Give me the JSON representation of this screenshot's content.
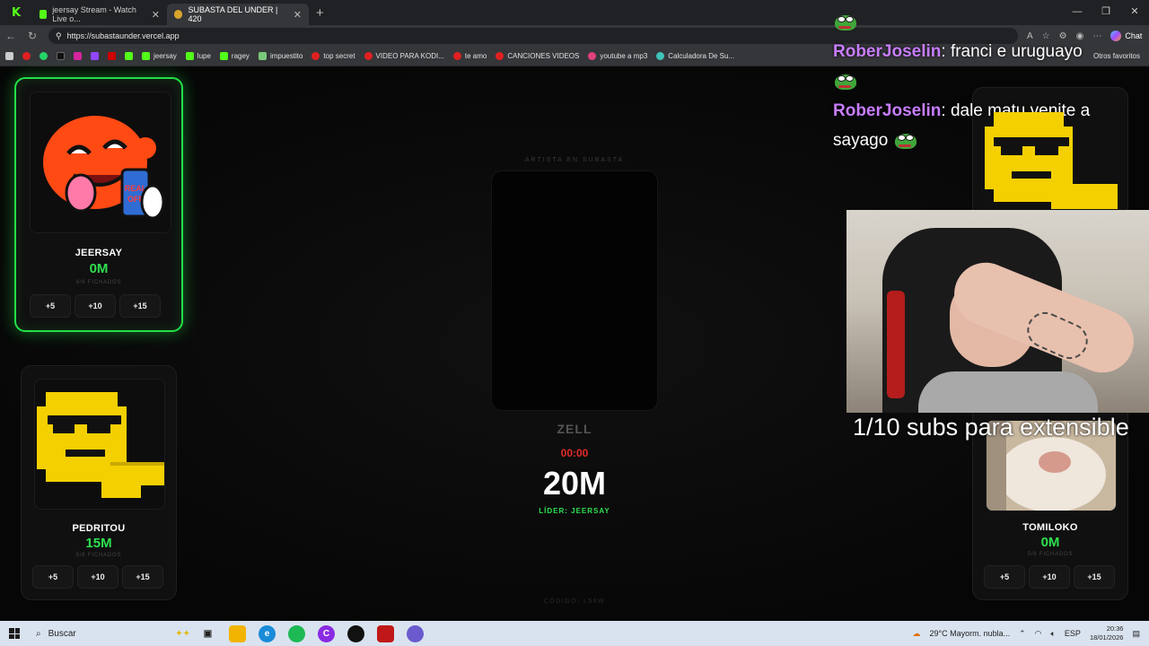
{
  "browser": {
    "tabs": [
      {
        "label": ""
      },
      {
        "label": "jeersay Stream - Watch Live o..."
      },
      {
        "label": "SUBASTA DEL UNDER | 420"
      }
    ],
    "new_tab": "+",
    "url": "https://subastaunder.vercel.app",
    "chat_label": "Chat",
    "bookmarks": [
      "",
      "",
      "",
      "",
      "",
      "",
      "jeersay",
      "lupe",
      "ragey",
      "impuestito",
      "top secret",
      "VIDEO PARA KODI...",
      "te amo",
      "CANCIONES VIDEOS",
      "youtube a mp3",
      "Calculadora De Su..."
    ],
    "bookmarks_right": "Otros favoritos"
  },
  "auction": {
    "center_label": "ARTISTA EN SUBASTA",
    "artist": "ZELL",
    "timer": "00:00",
    "current_bid": "20M",
    "leader": "LÍDER: JEERSAY",
    "faint": "",
    "code": "CÓDIGO: L56W"
  },
  "players": [
    {
      "name": "JEERSAY",
      "money": "0M",
      "signed": "6/6 FICHADOS",
      "bids": [
        "+5",
        "+10",
        "+15"
      ],
      "leader": true
    },
    {
      "name": "PEDRITOU",
      "money": "15M",
      "signed": "5/6 FICHADOS",
      "bids": [
        "+5",
        "+10",
        "+15"
      ],
      "leader": false
    },
    {
      "name": "TOMILOKO",
      "money": "0M",
      "signed": "5/6 FICHADOS",
      "bids": [
        "+5",
        "+10",
        "+15"
      ],
      "leader": false
    }
  ],
  "stream_chat": [
    {
      "user": "RoberJoselin",
      "text": "franci e uruguayo"
    },
    {
      "user": "RoberJoselin",
      "text": "dale matu venite a sayago"
    }
  ],
  "subs_goal": "1/10 subs para extensible",
  "taskbar": {
    "search": "Buscar",
    "weather": "29°C  Mayorm. nubla...",
    "lang": "ESP",
    "time": "20:36",
    "date": "18/01/2026"
  },
  "colors": {
    "accent_green": "#2ee04f",
    "timer_red": "#e52a2a",
    "chat_user": "#c77dff"
  }
}
